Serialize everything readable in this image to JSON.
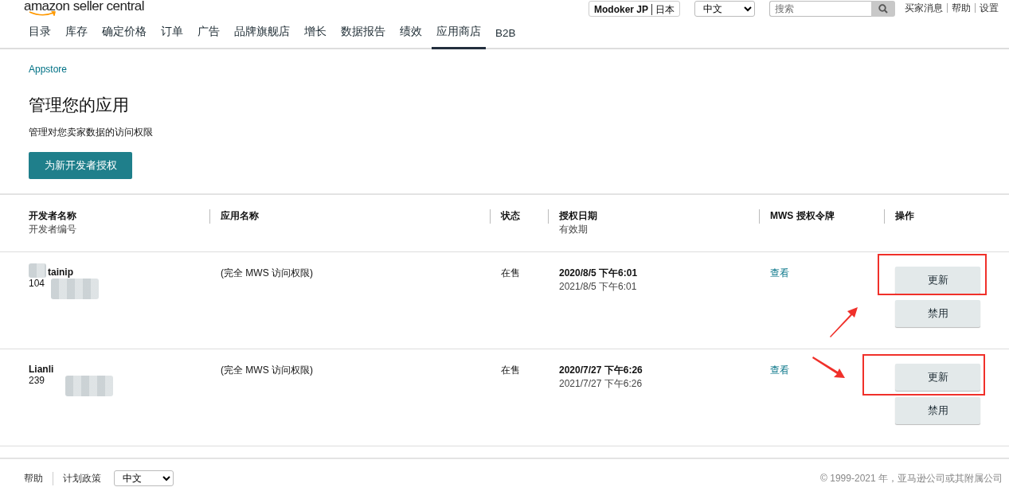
{
  "header": {
    "logo": "amazon seller central",
    "account": "Modoker JP",
    "region": "日本",
    "language": "中文",
    "search": {
      "placeholder": "搜索"
    },
    "links": [
      "买家消息",
      "帮助",
      "设置"
    ]
  },
  "nav": [
    {
      "label": "目录",
      "selected": false
    },
    {
      "label": "库存",
      "selected": false
    },
    {
      "label": "确定价格",
      "selected": false
    },
    {
      "label": "订单",
      "selected": false
    },
    {
      "label": "广告",
      "selected": false
    },
    {
      "label": "品牌旗舰店",
      "selected": false
    },
    {
      "label": "增长",
      "selected": false
    },
    {
      "label": "数据报告",
      "selected": false
    },
    {
      "label": "绩效",
      "selected": false
    },
    {
      "label": "应用商店",
      "selected": true
    },
    {
      "label": "B2B",
      "selected": false
    }
  ],
  "breadcrumb": "Appstore",
  "title": "管理您的应用",
  "subtitle": "管理对您卖家数据的访问权限",
  "primary_button": "为新开发者授权",
  "table": {
    "columns": [
      {
        "title": "开发者名称",
        "subtitle": "开发者编号"
      },
      {
        "title": "应用名称"
      },
      {
        "title": "状态"
      },
      {
        "title": "授权日期",
        "subtitle": "有效期"
      },
      {
        "title": "MWS 授权令牌"
      },
      {
        "title": "操作"
      }
    ],
    "rows": [
      {
        "developer_name": "tainip",
        "developer_id": "104",
        "app_name": "(完全 MWS 访问权限)",
        "status": "在售",
        "auth_date": "2020/8/5 下午6:01",
        "expiry": "2021/8/5 下午6:01",
        "token_link": "查看",
        "actions": [
          "更新",
          "禁用"
        ],
        "annotated": true,
        "arrow": {
          "kind": "up"
        }
      },
      {
        "developer_name": "Lianli",
        "developer_id": "239",
        "app_name": "(完全 MWS 访问权限)",
        "status": "在售",
        "auth_date": "2020/7/27 下午6:26",
        "expiry": "2021/7/27 下午6:26",
        "token_link": "查看",
        "actions": [
          "更新",
          "禁用"
        ],
        "annotated": true,
        "arrow": {
          "kind": "down"
        }
      }
    ]
  },
  "footer": {
    "links": [
      "帮助",
      "计划政策"
    ],
    "language": "中文",
    "copyright": "© 1999-2021 年，亚马逊公司或其附属公司"
  }
}
